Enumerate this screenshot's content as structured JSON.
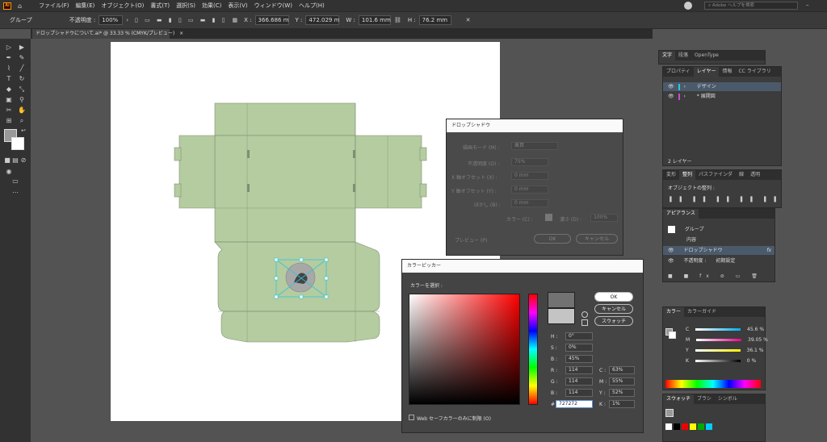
{
  "menubar": {
    "logo": "Ai",
    "items": [
      "ファイル(F)",
      "編集(E)",
      "オブジェクト(O)",
      "書式(T)",
      "選択(S)",
      "効果(C)",
      "表示(V)",
      "ウィンドウ(W)",
      "ヘルプ(H)"
    ],
    "search_placeholder": "Adobe ヘルプを検索"
  },
  "controlbar": {
    "selection": "グループ",
    "opacity_label": "不透明度 :",
    "opacity_value": "100%",
    "x_label": "X :",
    "x_value": "366.686 m",
    "y_label": "Y :",
    "y_value": "472.029 m",
    "w_label": "W :",
    "w_value": "101.6 mm",
    "h_label": "H :",
    "h_value": "76.2 mm"
  },
  "document_tab": {
    "title": "ドロップシャドウについて.ai* @ 33.33 % (CMYK/プレビュー)",
    "close": "×"
  },
  "drop_shadow_dialog": {
    "title": "ドロップシャドウ",
    "mode_label": "描画モード (M) :",
    "mode_value": "乗算",
    "opacity_label": "不透明度 (O) :",
    "opacity_value": "75%",
    "xoffset_label": "X 軸オフセット (X) :",
    "xoffset_value": "0 mm",
    "yoffset_label": "Y 軸オフセット (Y) :",
    "yoffset_value": "0 mm",
    "blur_label": "ぼかし (B) :",
    "blur_value": "0 mm",
    "color_label": "カラー (C) :",
    "darkness_label": "濃さ (D) :",
    "darkness_value": "100%",
    "preview_label": "プレビュー (P)",
    "ok": "OK",
    "cancel": "キャンセル"
  },
  "color_picker": {
    "title": "カラーピッカー",
    "select_label": "カラーを選択 :",
    "ok": "OK",
    "cancel": "キャンセル",
    "swatch": "スウォッチ",
    "fields": {
      "h_label": "H :",
      "h_value": "0°",
      "s_label": "S :",
      "s_value": "0%",
      "b_label": "B :",
      "b_value": "45%",
      "r_label": "R :",
      "r_value": "114",
      "g_label": "G :",
      "g_value": "114",
      "b2_label": "B :",
      "b2_value": "114",
      "hex_label": "#",
      "hex_value": "727272",
      "c_label": "C :",
      "c_value": "63%",
      "m_label": "M :",
      "m_value": "55%",
      "y_label": "Y :",
      "y_value": "52%",
      "k_label": "K :",
      "k_value": "1%"
    },
    "web_only_label": "Web セーフカラーのみに制限 (O)",
    "new_color": "#727272",
    "old_color": "#c4c4c4"
  },
  "panels": {
    "text_tabs": [
      "文字",
      "段落",
      "OpenType"
    ],
    "layer_tabs": [
      "プロパティ",
      "レイヤー",
      "情報",
      "CC ライブラリ"
    ],
    "layers": [
      "デザイン",
      "* 展開図"
    ],
    "layer_count": "2 レイヤー",
    "transform_tabs": [
      "変形",
      "整列",
      "パスファインダ",
      "線",
      "透明"
    ],
    "align_label": "オブジェクトの整列 :",
    "appearance_tab": "アピアランス",
    "appearance_rows": [
      "グループ",
      "内容",
      "ドロップシャドウ",
      "不透明度 :",
      "初期設定"
    ],
    "fx": "fx",
    "color_tabs": [
      "カラー",
      "カラーガイド"
    ],
    "color_rows": [
      {
        "label": "C",
        "value": "45.6",
        "unit": "%"
      },
      {
        "label": "M",
        "value": "39.05",
        "unit": "%"
      },
      {
        "label": "Y",
        "value": "36.1",
        "unit": "%"
      },
      {
        "label": "K",
        "value": "0",
        "unit": "%"
      }
    ],
    "swatch_tabs": [
      "スウォッチ",
      "ブラシ",
      "シンボル"
    ]
  },
  "colors": {
    "accent": "#1d6fb5",
    "box_fill": "#b4cca0",
    "box_stroke": "#7f8f72",
    "selection": "#2ec6d8"
  }
}
